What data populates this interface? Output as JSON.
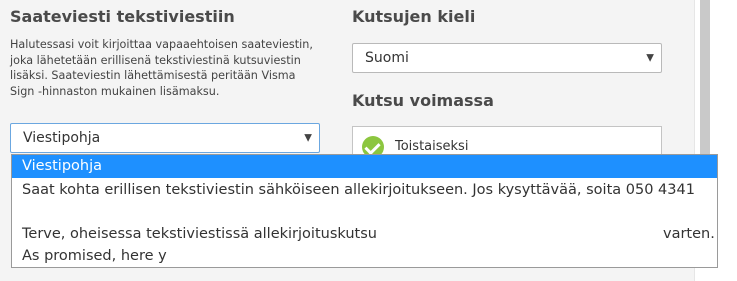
{
  "left": {
    "heading": "Saateviesti tekstiviestiin",
    "description": "Halutessasi voit kirjoittaa vapaaehtoisen saateviestin, joka lähetetään erillisenä tekstiviestinä kutsuviestin lisäksi. Saateviestin lähettämisestä peritään Visma Sign -hinnaston mukainen lisämaksu.",
    "select_value": "Viestipohja"
  },
  "right": {
    "language_heading": "Kutsujen kieli",
    "language_value": "Suomi",
    "validity_heading": "Kutsu voimassa",
    "validity_value": "Toistaiseksi"
  },
  "dropdown": {
    "options": [
      "Viestipohja",
      "Saat kohta erillisen tekstiviestin sähköiseen allekirjoitukseen. Jos kysyttävää, soita 050 4341",
      "Terve, oheisessa tekstiviestissä allekirjoituskutsu",
      "As promised, here y"
    ],
    "option_2_tail": "varten."
  },
  "icons": {
    "select_caret": "caret-down-icon",
    "validity_check": "check-circle-icon"
  },
  "colors": {
    "highlight": "#1e90ff",
    "check": "#8cc63f"
  }
}
